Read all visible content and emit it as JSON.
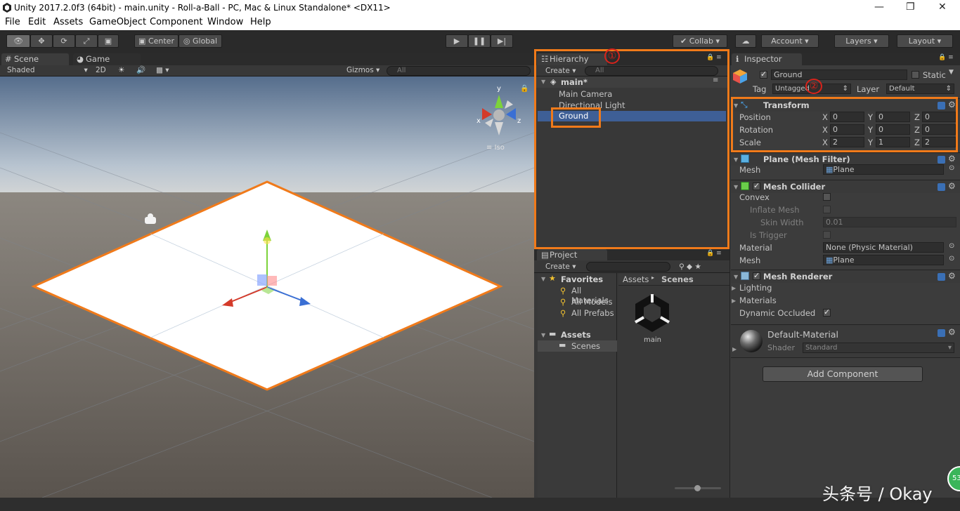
{
  "window": {
    "title": "Unity 2017.2.0f3 (64bit) - main.unity - Roll-a-Ball - PC, Mac & Linux Standalone* <DX11>",
    "minimize": "—",
    "restore": "❐",
    "close": "✕"
  },
  "menu": [
    "File",
    "Edit",
    "Assets",
    "GameObject",
    "Component",
    "Window",
    "Help"
  ],
  "toolbar": {
    "center": "Center",
    "global": "Global",
    "collab": "Collab",
    "account": "Account",
    "layers": "Layers",
    "layout": "Layout"
  },
  "scene": {
    "tab": "Scene",
    "game_tab": "Game",
    "shading": "Shaded",
    "mode2d": "2D",
    "gizmos": "Gizmos",
    "search_placeholder": "All",
    "persp": "Iso",
    "axes": {
      "x": "x",
      "y": "y",
      "z": "z"
    }
  },
  "hierarchy": {
    "tab": "Hierarchy",
    "create": "Create",
    "search_placeholder": "All",
    "scene_name": "main*",
    "items": [
      "Main Camera",
      "Directional Light",
      "Ground"
    ],
    "marker": "①"
  },
  "project": {
    "tab": "Project",
    "create": "Create",
    "favorites": "Favorites",
    "fav_items": [
      "All Materials",
      "All Models",
      "All Prefabs"
    ],
    "assets": "Assets",
    "folders": [
      "Scenes"
    ],
    "breadcrumb": [
      "Assets",
      "Scenes"
    ],
    "asset_items": [
      "main"
    ]
  },
  "inspector": {
    "tab": "Inspector",
    "object_name": "Ground",
    "static_label": "Static",
    "tag_label": "Tag",
    "tag_value": "Untagged",
    "layer_label": "Layer",
    "layer_value": "Default",
    "marker": "②",
    "transform": {
      "title": "Transform",
      "rows": [
        {
          "label": "Position",
          "x": "0",
          "y": "0",
          "z": "0"
        },
        {
          "label": "Rotation",
          "x": "0",
          "y": "0",
          "z": "0"
        },
        {
          "label": "Scale",
          "x": "2",
          "y": "1",
          "z": "2"
        }
      ]
    },
    "mesh_filter": {
      "title": "Plane (Mesh Filter)",
      "mesh_label": "Mesh",
      "mesh_value": "Plane"
    },
    "mesh_collider": {
      "title": "Mesh Collider",
      "convex": "Convex",
      "inflate": "Inflate Mesh",
      "skin": "Skin Width",
      "skin_value": "0.01",
      "trigger": "Is Trigger",
      "material_label": "Material",
      "material_value": "None (Physic Material)",
      "mesh_label": "Mesh",
      "mesh_value": "Plane"
    },
    "mesh_renderer": {
      "title": "Mesh Renderer",
      "lighting": "Lighting",
      "materials": "Materials",
      "dynamic": "Dynamic Occluded"
    },
    "material": {
      "name": "Default-Material",
      "shader_label": "Shader",
      "shader_value": "Standard"
    },
    "add_component": "Add Component"
  },
  "watermark": "头条号 / Okay",
  "badge": "53",
  "colors": {
    "highlight": "#f07a1a",
    "selection": "#3e5f96"
  }
}
